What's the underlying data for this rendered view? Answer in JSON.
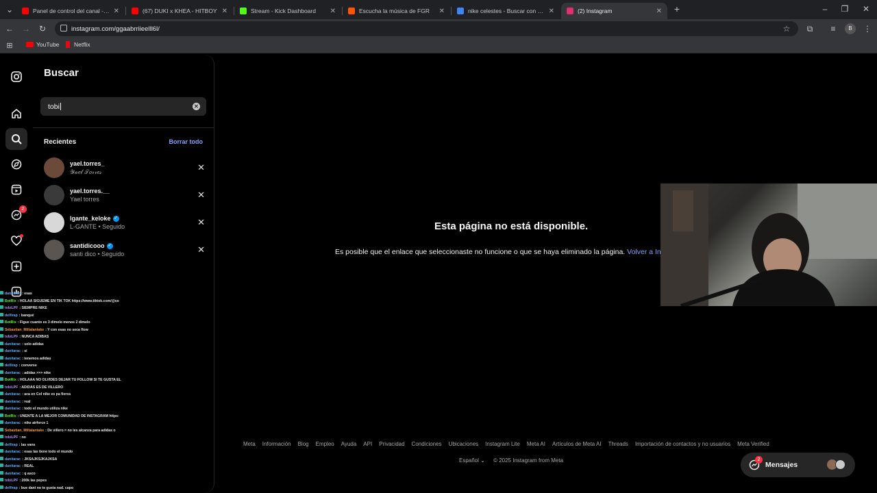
{
  "browser": {
    "tabs": [
      {
        "title": "Panel de control del canal - You",
        "color": "#ff0000",
        "active": false
      },
      {
        "title": "(67) DUKI x KHEA - HITBOY",
        "color": "#ff0000",
        "active": false
      },
      {
        "title": "Stream - Kick Dashboard",
        "color": "#53fc18",
        "active": false
      },
      {
        "title": "Escucha la música de FGR",
        "color": "#ff5500",
        "active": false
      },
      {
        "title": "nike celestes - Buscar con Goo",
        "color": "#4285f4",
        "active": false
      },
      {
        "title": "(2) Instagram",
        "color": "#e1306c",
        "active": true
      }
    ],
    "url": "instagram.com/ggaabrriieelll6l/",
    "bookmarks": [
      {
        "label": "YouTube",
        "color": "#ff0000"
      },
      {
        "label": "Netflix",
        "color": "#e50914"
      }
    ],
    "profile_initial": "B"
  },
  "sidebar": {
    "notifications_badge": "2"
  },
  "search": {
    "title": "Buscar",
    "query": "tobi",
    "recent_header": "Recientes",
    "clear_all": "Borrar todo",
    "recent": [
      {
        "username": "yael.torres_",
        "subtitle": "𝒴𝒶𝑒𝓁 𝒯𝑜𝓇𝓇𝑒𝓈",
        "verified": false,
        "avatar_color": "#6b4a3a"
      },
      {
        "username": "yael.torres.__",
        "subtitle": "Yael torres",
        "verified": false,
        "avatar_color": "#3a3a3a"
      },
      {
        "username": "lgante_keloke",
        "subtitle": "L-GANTE • Seguido",
        "verified": true,
        "avatar_color": "#d8d8d8"
      },
      {
        "username": "santidicooo",
        "subtitle": "santi dico • Seguido",
        "verified": true,
        "avatar_color": "#5a5550"
      }
    ]
  },
  "main": {
    "title": "Esta página no está disponible.",
    "description": "Es posible que el enlace que seleccionaste no funcione o que se haya eliminado la página.",
    "link": "Volver a In"
  },
  "footer": {
    "links": [
      "Meta",
      "Información",
      "Blog",
      "Empleo",
      "Ayuda",
      "API",
      "Privacidad",
      "Condiciones",
      "Ubicaciones",
      "Instagram Lite",
      "Meta AI",
      "Artículos de Meta AI",
      "Threads",
      "Importación de contactos y no usuarios",
      "Meta Verified"
    ],
    "language": "Español",
    "copyright": "© 2025 Instagram from Meta"
  },
  "messages": {
    "label": "Mensajes",
    "badge": "2"
  },
  "chat": [
    {
      "user": "danitarac",
      "color": "#5ab0ff",
      "text": ": esas"
    },
    {
      "user": "BotRix",
      "color": "#53fc18",
      "text": ": HOLAA SIGUEME EN TIK TOK https://www.tiktok.com/@so"
    },
    {
      "user": "tobiLPF",
      "color": "#b388ff",
      "text": ": SIEMPRE NIKE"
    },
    {
      "user": "delfirap",
      "color": "#5ab0ff",
      "text": ": banqué"
    },
    {
      "user": "BotRix",
      "color": "#53fc18",
      "text": ": Figue cuanto es 3 dimelo menos 2 dimelo"
    },
    {
      "user": "Sebastian_Miltalantake",
      "color": "#ff9a3c",
      "text": ": Y con esas no seca flow"
    },
    {
      "user": "tobiLPF",
      "color": "#b388ff",
      "text": ": NUNCA ADIBAS"
    },
    {
      "user": "danitarac",
      "color": "#5ab0ff",
      "text": ": solo adidas"
    },
    {
      "user": "danitarac",
      "color": "#5ab0ff",
      "text": ": si"
    },
    {
      "user": "danitarac",
      "color": "#5ab0ff",
      "text": ": tenemos adidas"
    },
    {
      "user": "delfirap",
      "color": "#5ab0ff",
      "text": ": converse"
    },
    {
      "user": "danitarac",
      "color": "#5ab0ff",
      "text": ": adidas >>> nike"
    },
    {
      "user": "BotRix",
      "color": "#53fc18",
      "text": ": HOLAAA NO OLVIDES DEJAR TU FOLLOW SI TE GUSTA EL"
    },
    {
      "user": "tobiLPF",
      "color": "#b388ff",
      "text": ": ADIDAS ES DE VILLERO"
    },
    {
      "user": "danitarac",
      "color": "#5ab0ff",
      "text": ": aca en Col nike es pa fieros"
    },
    {
      "user": "danitarac",
      "color": "#5ab0ff",
      "text": ": real"
    },
    {
      "user": "danitarac",
      "color": "#5ab0ff",
      "text": ": todo el mundo utiliza nike"
    },
    {
      "user": "BotRix",
      "color": "#53fc18",
      "text": ": UNENTE A LA MEJOR COMUNIDAD DE INSTAGRAM https:"
    },
    {
      "user": "danitarac",
      "color": "#5ab0ff",
      "text": ": nike airforce 1"
    },
    {
      "user": "Sebastian_Miltalantake",
      "color": "#ff9a3c",
      "text": ": De villero = no les alcanza para adidas o"
    },
    {
      "user": "tobiLPF",
      "color": "#b388ff",
      "text": ": no"
    },
    {
      "user": "delfirap",
      "color": "#5ab0ff",
      "text": ": las vans"
    },
    {
      "user": "danitarac",
      "color": "#5ab0ff",
      "text": ": esas las tiene todo el mundo"
    },
    {
      "user": "danitarac",
      "color": "#5ab0ff",
      "text": ": JKSAJKSJKAJKSA"
    },
    {
      "user": "danitarac",
      "color": "#5ab0ff",
      "text": ": REAL"
    },
    {
      "user": "danitarac",
      "color": "#5ab0ff",
      "text": ": q asco"
    },
    {
      "user": "tobiLPF",
      "color": "#b388ff",
      "text": ": 200k las pepes"
    },
    {
      "user": "delfirap",
      "color": "#5ab0ff",
      "text": ": bue dani no te gusta nad. capo"
    }
  ]
}
